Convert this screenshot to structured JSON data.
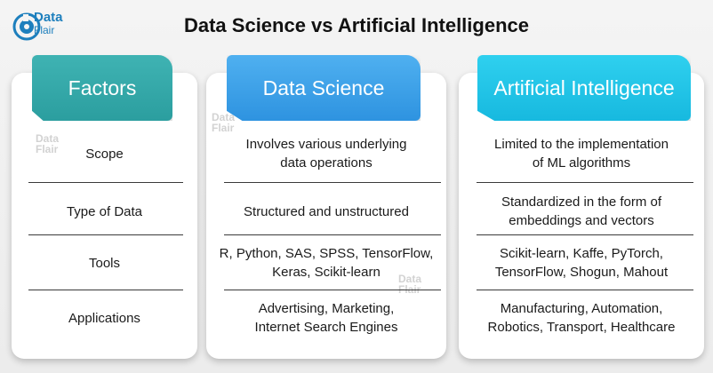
{
  "brand": {
    "line1": "Data",
    "line2": "Flair"
  },
  "title": "Data Science vs Artificial Intelligence",
  "headers": [
    "Factors",
    "Data Science",
    "Artificial Intelligence"
  ],
  "rows": [
    {
      "factor": "Scope",
      "ds": [
        "Involves various underlying",
        "data operations"
      ],
      "ai": [
        "Limited to the implementation",
        "of ML algorithms"
      ]
    },
    {
      "factor": "Type of Data",
      "ds": [
        "Structured and unstructured"
      ],
      "ai": [
        "Standardized in the form of",
        "embeddings and vectors"
      ]
    },
    {
      "factor": "Tools",
      "ds": [
        "R, Python, SAS, SPSS, TensorFlow,",
        "Keras, Scikit-learn"
      ],
      "ai": [
        "Scikit-learn, Kaffe, PyTorch,",
        "TensorFlow, Shogun, Mahout"
      ]
    },
    {
      "factor": "Applications",
      "ds": [
        "Advertising, Marketing,",
        "Internet Search Engines"
      ],
      "ai": [
        "Manufacturing, Automation,",
        "Robotics, Transport, Healthcare"
      ]
    }
  ],
  "colors": {
    "factors_header": "#2b9e9f",
    "ds_header": "#2e93e0",
    "ai_header": "#17b9df",
    "logo": "#1d7fbd"
  }
}
